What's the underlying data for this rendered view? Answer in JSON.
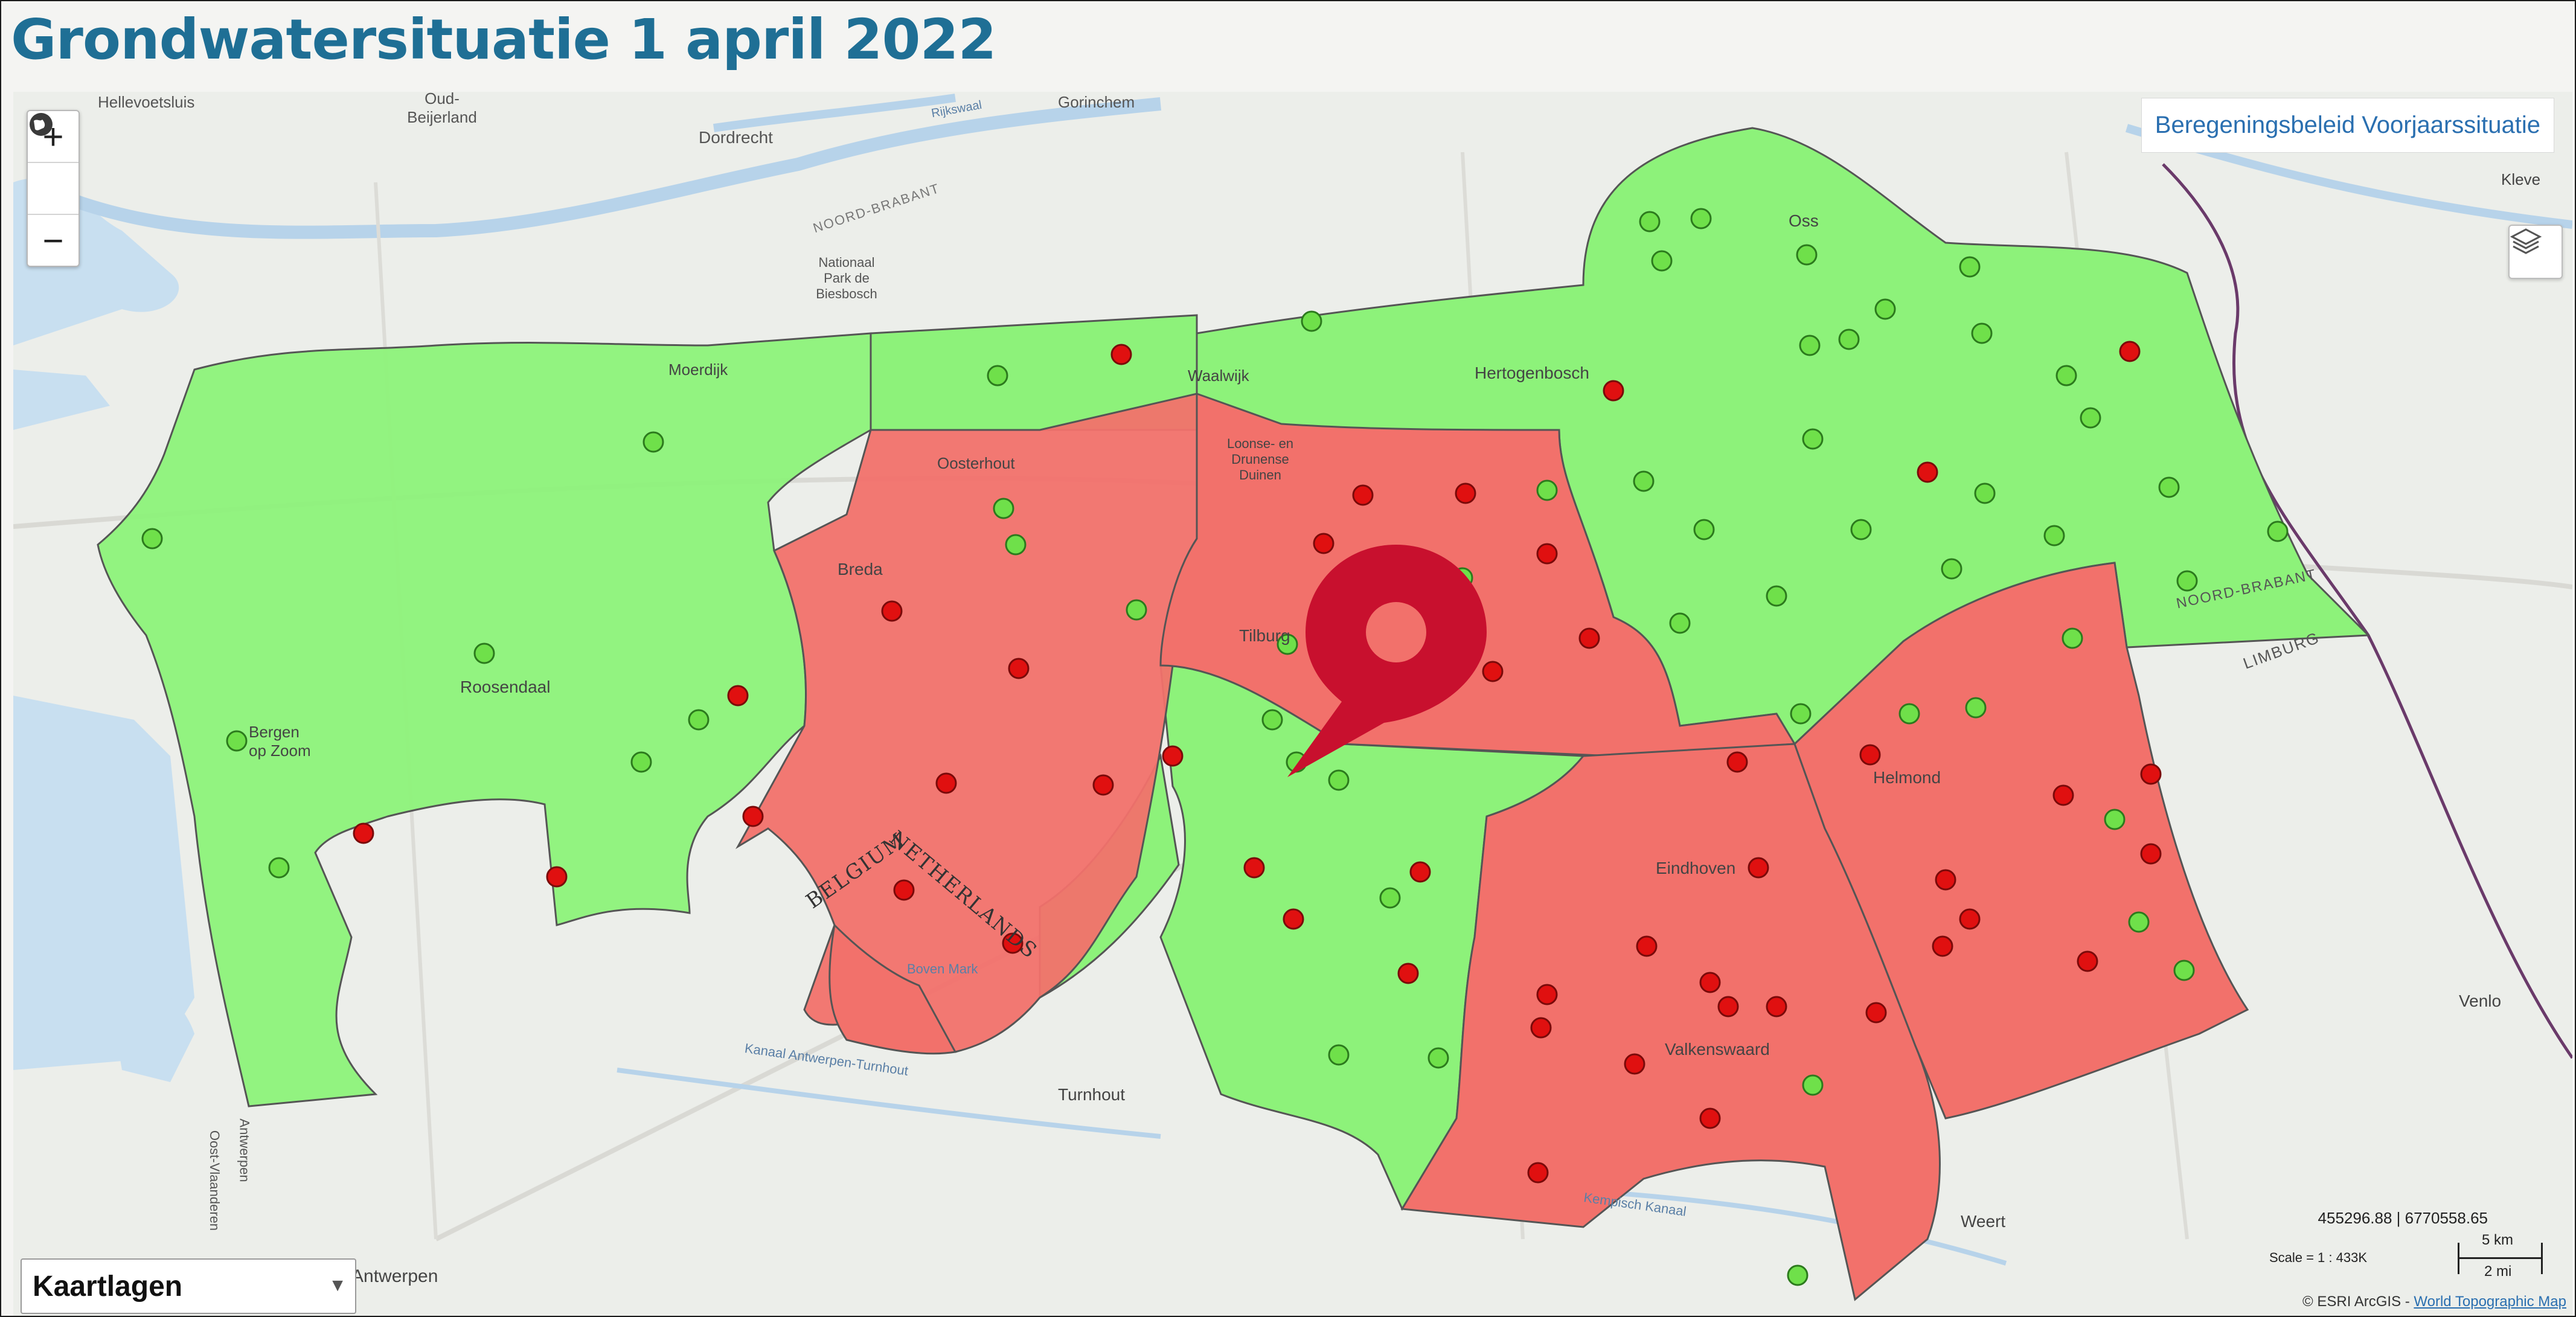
{
  "page_title": "Grondwatersituatie 1 april 2022",
  "map": {
    "policy_label": "Beregeningsbeleid Voorjaarssituatie",
    "layers_panel_label": "Kaartlagen",
    "zoom_in_label": "+",
    "zoom_out_label": "−",
    "layers_icon": "layers-icon",
    "globe_icon": "globe-icon",
    "coordinates": "455296.88 | 6770558.65",
    "scale_ratio": "Scale = 1 : 433K",
    "scale_km": "5 km",
    "scale_mi": "2 mi",
    "attribution_prefix": "© ESRI ArcGIS - ",
    "attribution_link": "World Topographic Map",
    "colors": {
      "green_zone": "#8df27a",
      "red_zone": "#f2716b",
      "green_point": "#6fe04a",
      "red_point": "#e01010",
      "marker": "#c8102e",
      "water": "#c8dff0"
    },
    "place_labels": [
      "Hellevoetsluis",
      "Oud-Beijerland",
      "Dordrecht",
      "Gorinchem",
      "NOORD-BRABANT",
      "Nationaal Park de Biesbosch",
      "Moerdijk",
      "Waalwijk",
      "Hertogenbosch",
      "Oss",
      "Oosterhout",
      "Loonse- en Drunense Duinen",
      "Breda",
      "Tilburg",
      "Roosendaal",
      "Bergen op Zoom",
      "BELGIUM",
      "NETHERLANDS",
      "Eindhoven",
      "Helmond",
      "Valkenswaard",
      "Turnhout",
      "Weert",
      "Venlo",
      "Kleve",
      "LIMBURG",
      "Antwerpen",
      "Antwerpen",
      "Oost-Vlaanderen",
      "Kempisch Kanaal",
      "Kanaal Antwerpen-Turnhout",
      "Boven Mark",
      "Rijkswaal",
      "NOORD-BRABANT"
    ],
    "marker_icon": "location-pin-icon"
  }
}
